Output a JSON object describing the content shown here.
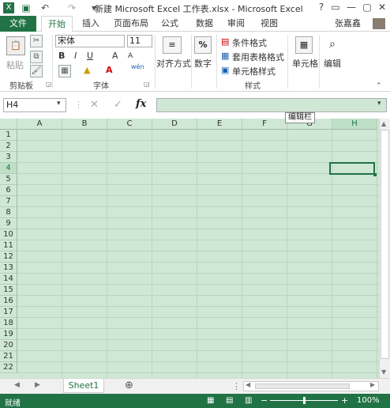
{
  "window": {
    "title": "新建 Microsoft Excel 工作表.xlsx - Microsoft Excel",
    "controls": [
      "?",
      "▭",
      "—",
      "▢",
      "✕"
    ],
    "user": "张嘉鑫"
  },
  "tabs": [
    {
      "label": "文件"
    },
    {
      "label": "开始"
    },
    {
      "label": "插入"
    },
    {
      "label": "页面布局"
    },
    {
      "label": "公式"
    },
    {
      "label": "数据"
    },
    {
      "label": "审阅"
    },
    {
      "label": "视图"
    }
  ],
  "ribbon": {
    "clipboard": {
      "paste": "粘贴",
      "label": "剪贴板"
    },
    "font": {
      "name": "宋体",
      "size": "11",
      "bold": "B",
      "italic": "I",
      "underline": "U",
      "grow": "A",
      "shrink": "A",
      "label": "字体",
      "wen": "wén"
    },
    "alignment": {
      "label": "对齐方式"
    },
    "number": {
      "label": "数字",
      "symbol": "%"
    },
    "styles": {
      "cond": "条件格式",
      "table": "套用表格格式",
      "cell": "单元格样式",
      "label": "样式"
    },
    "cells": {
      "label": "单元格"
    },
    "editing": {
      "label": "编辑"
    }
  },
  "formula_bar": {
    "namebox": "H4",
    "cancel": "✕",
    "enter": "✓",
    "fx": "fx",
    "tooltip": "编辑栏"
  },
  "grid": {
    "columns": [
      "A",
      "B",
      "C",
      "D",
      "E",
      "F",
      "G",
      "H"
    ],
    "rows": [
      "1",
      "2",
      "3",
      "4",
      "5",
      "6",
      "7",
      "8",
      "9",
      "10",
      "11",
      "12",
      "13",
      "14",
      "15",
      "16",
      "17",
      "18",
      "19",
      "20",
      "21",
      "22"
    ],
    "selected": "H4"
  },
  "sheets": {
    "tabs": [
      "Sheet1"
    ],
    "add": "⊕"
  },
  "status": {
    "mode": "就绪",
    "zoom": "100%",
    "minus": "−",
    "plus": "+"
  },
  "colors": {
    "accent": "#217346",
    "grid_bg": "#cfe8d6"
  }
}
